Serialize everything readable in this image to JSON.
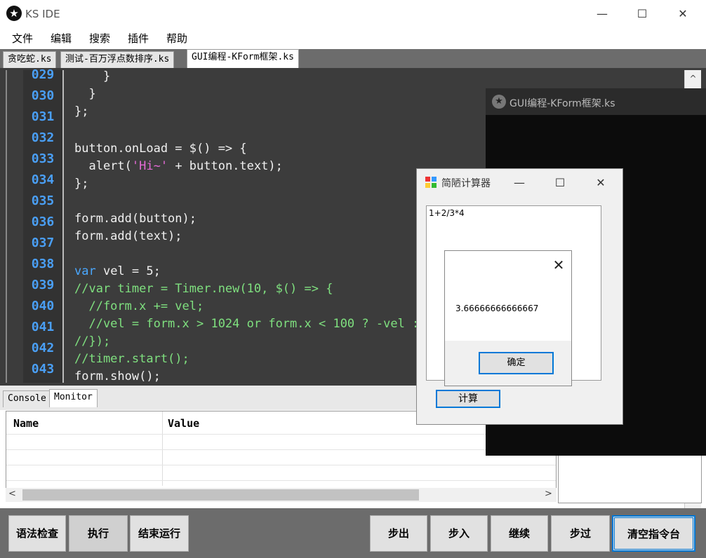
{
  "window": {
    "title": "KS IDE",
    "minimize": "—",
    "maximize": "☐",
    "close": "✕",
    "logo": "★"
  },
  "menu": [
    "文件",
    "编辑",
    "搜索",
    "插件",
    "帮助"
  ],
  "tabs": [
    "贪吃蛇.ks",
    "测试-百万浮点数排序.ks",
    "GUI编程-KForm框架.ks"
  ],
  "editor": {
    "line_numbers": [
      "029",
      "030",
      "031",
      "032",
      "033",
      "034",
      "035",
      "036",
      "037",
      "038",
      "039",
      "040",
      "041",
      "042",
      "043"
    ]
  },
  "panel": {
    "tabs": [
      "Console",
      "Monitor"
    ],
    "columns": [
      "Name",
      "Value"
    ],
    "scroll_left": "<",
    "scroll_right": ">"
  },
  "scroll_up": "^",
  "buttons": {
    "check": "语法检查",
    "run": "执行",
    "stop": "结束运行",
    "step_out": "步出",
    "step_in": "步入",
    "continue": "继续",
    "step_over": "步过",
    "clear": "清空指令台"
  },
  "output_window": {
    "title": "GUI编程-KForm框架.ks",
    "logo": "★"
  },
  "calc_window": {
    "title": "简陋计算器",
    "minimize": "—",
    "maximize": "☐",
    "close": "✕",
    "input": "1+2/3*4",
    "compute": "计算"
  },
  "message": {
    "close": "✕",
    "text": "3.66666666666667",
    "ok": "确定"
  }
}
